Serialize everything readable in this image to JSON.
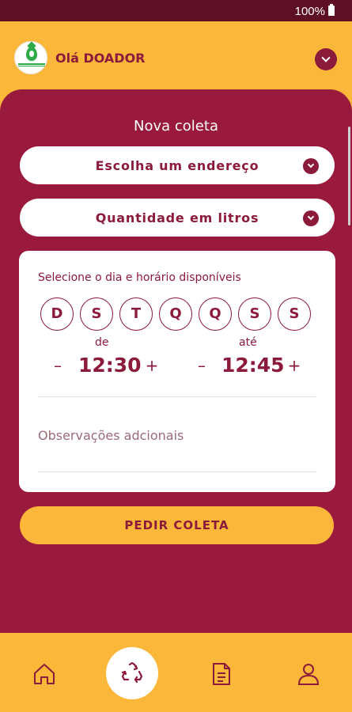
{
  "status_bar": {
    "battery": "100%"
  },
  "header": {
    "greeting": "Olá DOADOR"
  },
  "form": {
    "title": "Nova coleta",
    "address_label": "Escolha um endereço",
    "quantity_label": "Quantidade em litros",
    "schedule_label": "Selecione o dia e horário disponíveis",
    "days": [
      "D",
      "S",
      "T",
      "Q",
      "Q",
      "S",
      "S"
    ],
    "from_label": "de",
    "from_time": "12:30",
    "to_label": "até",
    "to_time": "12:45",
    "decrement_symbol": "–",
    "increment_symbol": "+",
    "observations_placeholder": "Observações adcionais",
    "submit_label": "PEDIR COLETA"
  },
  "colors": {
    "primary": "#9a1a3d",
    "accent": "#fbb73a",
    "text": "#8b1a3b",
    "status_bar": "#5e0f26"
  },
  "nav": {
    "items": [
      {
        "name": "home",
        "icon": "home-icon"
      },
      {
        "name": "collect",
        "icon": "recycle-icon"
      },
      {
        "name": "documents",
        "icon": "document-icon"
      },
      {
        "name": "profile",
        "icon": "user-icon"
      }
    ]
  }
}
